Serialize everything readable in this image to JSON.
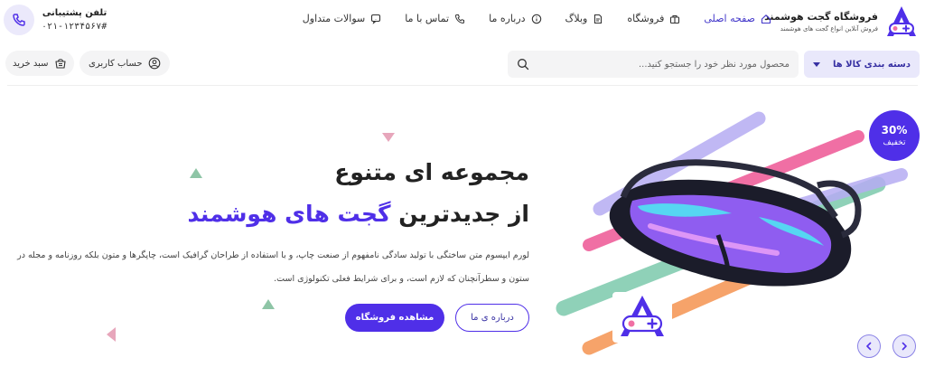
{
  "brand": {
    "name": "فروشگاه گجت هوشمند",
    "tagline": "فروش آنلاین انواع گجت های هوشمند"
  },
  "nav": {
    "items": [
      {
        "label": "صفحه اصلی",
        "icon": "home-icon",
        "active": true
      },
      {
        "label": "فروشگاه",
        "icon": "shop-icon"
      },
      {
        "label": "وبلاگ",
        "icon": "blog-icon"
      },
      {
        "label": "درباره ما",
        "icon": "info-icon"
      },
      {
        "label": "تماس با ما",
        "icon": "phone-icon"
      },
      {
        "label": "سوالات متداول",
        "icon": "faq-icon"
      }
    ]
  },
  "support": {
    "title": "تلفن پشتیبانی",
    "phone": "۰۲۱-۱۲۳۴۵۶۷#"
  },
  "search": {
    "category_label": "دسته بندی کالا ها",
    "placeholder": "محصول مورد نظر خود را جستجو کنید..."
  },
  "user": {
    "account_label": "حساب کاربری",
    "cart_label": "سبد خرید"
  },
  "hero": {
    "title_line1": "مجموعه ای متنوع",
    "title_line2_prefix": "از جدیدترین",
    "title_line2_accent": "گجت های هوشمند",
    "description": "لورم ایپسوم متن ساختگی با تولید سادگی نامفهوم از صنعت چاپ، و با استفاده از طراحان گرافیک است، چاپگرها و متون بلکه روزنامه و مجله در ستون و سطرآنچنان که لازم است، و برای شرایط فعلی تکنولوژی است.",
    "shop_button": "مشاهده فروشگاه",
    "about_button": "درباره ی ما",
    "discount_percent": "30%",
    "discount_label": "تخفیف"
  },
  "colors": {
    "accent": "#4f2fe8",
    "accent_soft": "#e9e8fb",
    "stripe_purple": "#b6acf3",
    "stripe_pink": "#f06fa4",
    "stripe_mint": "#8fd1b8",
    "stripe_orange": "#f6a36a",
    "triangle_pink": "#e7a6bb",
    "triangle_green": "#8ec5a6"
  }
}
